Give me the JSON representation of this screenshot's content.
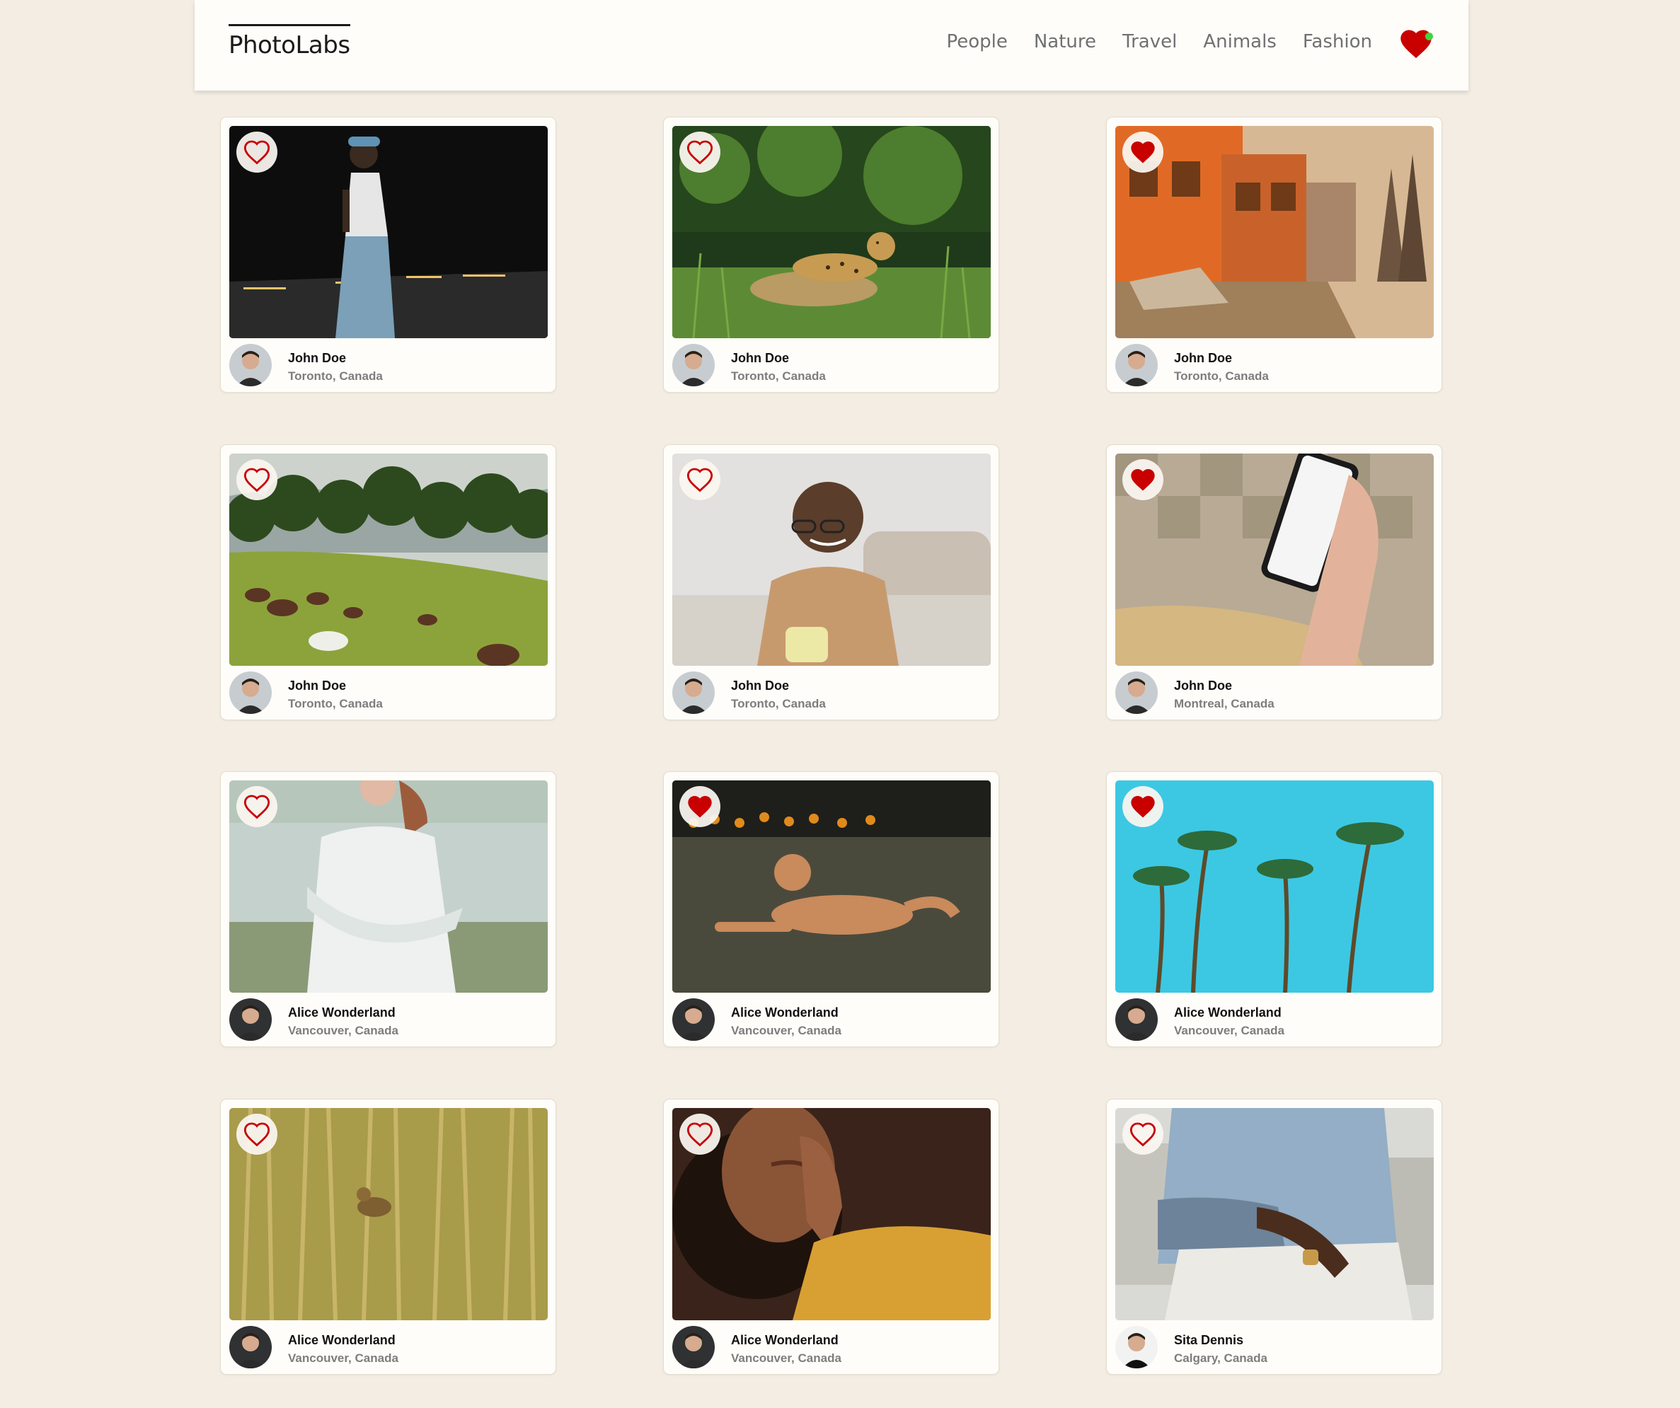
{
  "brand": {
    "logo": "PhotoLabs"
  },
  "nav": {
    "topics": [
      "People",
      "Nature",
      "Travel",
      "Animals",
      "Fashion"
    ],
    "favourites_icon": "heart-icon",
    "has_favourites_notification": true
  },
  "colors": {
    "page_background": "#f3ede3",
    "card_background": "#fefdf9",
    "heart_red": "#c80000",
    "notification_green": "#3fd441"
  },
  "photos": [
    {
      "name": "John Doe",
      "location": "Toronto, Canada",
      "liked": false,
      "scene": "man-street-night"
    },
    {
      "name": "John Doe",
      "location": "Toronto, Canada",
      "liked": false,
      "scene": "jaguar-grass"
    },
    {
      "name": "John Doe",
      "location": "Toronto, Canada",
      "liked": true,
      "scene": "orange-buildings-street"
    },
    {
      "name": "John Doe",
      "location": "Toronto, Canada",
      "liked": false,
      "scene": "horses-hillside"
    },
    {
      "name": "John Doe",
      "location": "Toronto, Canada",
      "liked": false,
      "scene": "smiling-man-mug"
    },
    {
      "name": "John Doe",
      "location": "Montreal, Canada",
      "liked": true,
      "scene": "hand-holding-phone"
    },
    {
      "name": "Alice Wonderland",
      "location": "Vancouver, Canada",
      "liked": false,
      "scene": "woman-white-top-lake"
    },
    {
      "name": "Alice Wonderland",
      "location": "Vancouver, Canada",
      "liked": true,
      "scene": "dog-lying-grass"
    },
    {
      "name": "Alice Wonderland",
      "location": "Vancouver, Canada",
      "liked": true,
      "scene": "palm-trees-blue-sky"
    },
    {
      "name": "Alice Wonderland",
      "location": "Vancouver, Canada",
      "liked": false,
      "scene": "bird-in-reeds"
    },
    {
      "name": "Alice Wonderland",
      "location": "Vancouver, Canada",
      "liked": false,
      "scene": "woman-curly-hair"
    },
    {
      "name": "Sita Dennis",
      "location": "Calgary, Canada",
      "liked": false,
      "scene": "man-denim-shirt-crouching"
    }
  ]
}
